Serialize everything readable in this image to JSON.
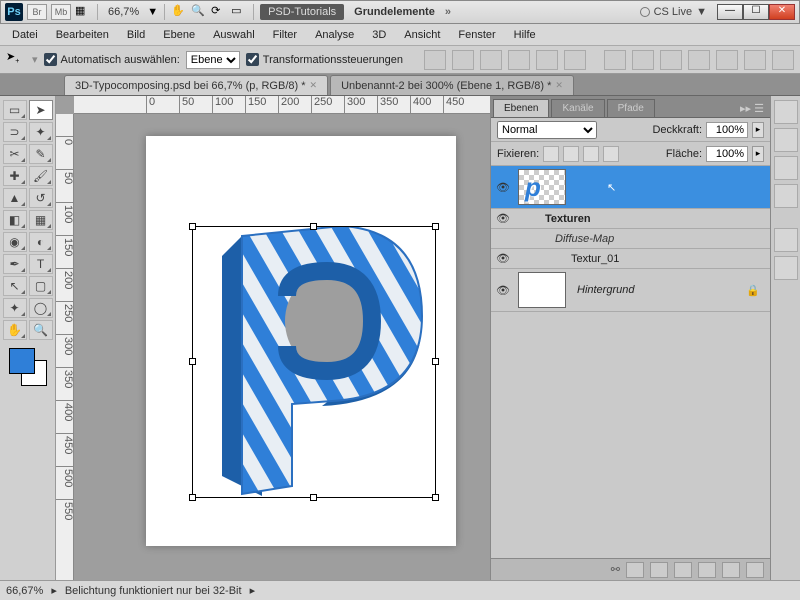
{
  "titlebar": {
    "app": "Ps",
    "labels": [
      "Br",
      "Mb"
    ],
    "zoom": "66,7%",
    "tag": "PSD-Tutorials",
    "doc": "Grundelemente",
    "cslive": "CS Live"
  },
  "menu": [
    "Datei",
    "Bearbeiten",
    "Bild",
    "Ebene",
    "Auswahl",
    "Filter",
    "Analyse",
    "3D",
    "Ansicht",
    "Fenster",
    "Hilfe"
  ],
  "options": {
    "auto": "Automatisch auswählen:",
    "layer_select": "Ebene",
    "transform": "Transformationssteuerungen"
  },
  "doctabs": [
    {
      "label": "3D-Typocomposing.psd bei 66,7% (p, RGB/8) *",
      "active": true
    },
    {
      "label": "Unbenannt-2 bei 300% (Ebene 1, RGB/8) *",
      "active": false
    }
  ],
  "ruler_ticks": [
    "0",
    "50",
    "100",
    "150",
    "200",
    "250",
    "300",
    "350",
    "400",
    "450"
  ],
  "vruler_ticks": [
    "0",
    "50",
    "100",
    "150",
    "200",
    "250",
    "300",
    "350",
    "400",
    "450",
    "500",
    "550"
  ],
  "panels": {
    "tabs": [
      "Ebenen",
      "Kanäle",
      "Pfade"
    ],
    "blend": "Normal",
    "opacity_label": "Deckkraft:",
    "opacity": "100%",
    "lock_label": "Fixieren:",
    "fill_label": "Fläche:",
    "fill": "100%",
    "layers": {
      "main": "",
      "textures": "Texturen",
      "diffuse": "Diffuse-Map",
      "tex1": "Textur_01",
      "bg": "Hintergrund"
    }
  },
  "status": {
    "zoom": "66,67%",
    "msg": "Belichtung funktioniert nur bei 32-Bit"
  },
  "chart_data": null
}
